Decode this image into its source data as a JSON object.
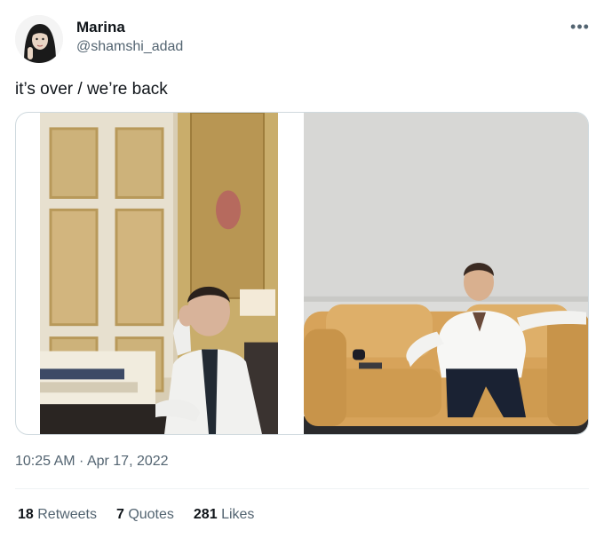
{
  "author": {
    "display_name": "Marina",
    "handle": "@shamshi_adad",
    "avatar_icon": "profile-photo"
  },
  "menu": {
    "more_icon": "more-options-icon",
    "more_glyph": "•••"
  },
  "tweet": {
    "text": "it’s over / we’re back"
  },
  "media": [
    {
      "name": "photo-office-desk",
      "description_icon": "photo"
    },
    {
      "name": "photo-yellow-sofa",
      "description_icon": "photo"
    }
  ],
  "timestamp": "10:25 AM · Apr 17, 2022",
  "stats": {
    "retweets": {
      "count": "18",
      "label": "Retweets"
    },
    "quotes": {
      "count": "7",
      "label": "Quotes"
    },
    "likes": {
      "count": "281",
      "label": "Likes"
    }
  },
  "colors": {
    "primary_text": "#0f1419",
    "secondary_text": "#536471",
    "border": "#cfd9de",
    "divider": "#eff3f4",
    "sofa": "#d7a35a",
    "wall": "#dcdcda",
    "gilded_wall": "#c9ad6b"
  }
}
